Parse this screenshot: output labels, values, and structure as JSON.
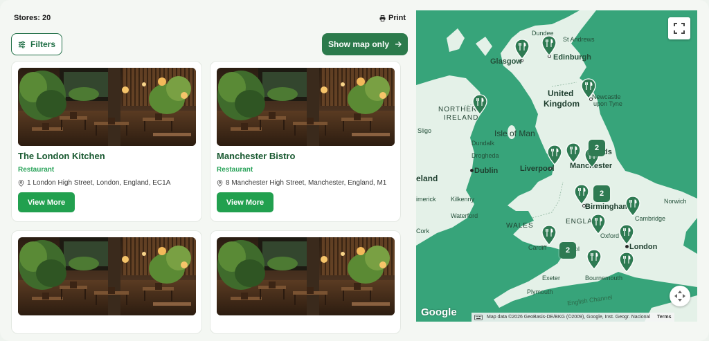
{
  "header": {
    "stores_count": "Stores: 20",
    "print_label": "Print"
  },
  "toolbar": {
    "filters_label": "Filters",
    "show_map_label": "Show map only"
  },
  "stores": [
    {
      "name": "The London Kitchen",
      "type": "Restaurant",
      "address": "1 London High Street, London, England, EC1A",
      "button": "View More"
    },
    {
      "name": "Manchester Bistro",
      "type": "Restaurant",
      "address": "8 Manchester High Street, Manchester, England, M1",
      "button": "View More"
    },
    {
      "name": "",
      "type": "",
      "address": "",
      "button": ""
    },
    {
      "name": "",
      "type": "",
      "address": "",
      "button": ""
    }
  ],
  "map": {
    "labels": {
      "dundee": "Dundee",
      "st_andrews": "St Andrews",
      "glasgow": "Glasgow",
      "edinburgh": "Edinburgh",
      "united": "United",
      "kingdom": "Kingdom",
      "newcastle1": "Newcastle",
      "newcastle2": "upon Tyne",
      "northern": "NORTHERN",
      "ireland_cap": "IRELAND",
      "isle_of_man": "Isle of Man",
      "sligo": "Sligo",
      "dundalk": "Dundalk",
      "drogheda": "Drogheda",
      "dublin": "Dublin",
      "liverpool": "Liverpool",
      "leeds": "ds",
      "manchester": "Manchester",
      "ireland": "eland",
      "limerick": "imerick",
      "kilkenny": "Kilkenny",
      "birmingham": "Birmingham",
      "norwich": "Norwich",
      "waterford": "Waterford",
      "wales": "WALES",
      "england": "ENGLA",
      "cambridge": "Cambridge",
      "cork": "Cork",
      "cardiff": "Cardiff",
      "bristol": "stol",
      "oxford": "Oxford",
      "london": "London",
      "exeter": "Exeter",
      "bournemouth": "Bournemouth",
      "plymouth": "Plymouth",
      "english_channel": "English Channel"
    },
    "clusters": [
      "2",
      "2",
      "2"
    ],
    "attribution": "Map data ©2026 GeoBasis-DE/BKG (©2009), Google, Inst. Geogr. Nacional",
    "terms": "Terms",
    "google": "Google"
  },
  "colors": {
    "brand_dark": "#2b7a4b",
    "brand_green": "#22a04f",
    "sea": "#37a47a",
    "land": "#e4f1e8"
  }
}
